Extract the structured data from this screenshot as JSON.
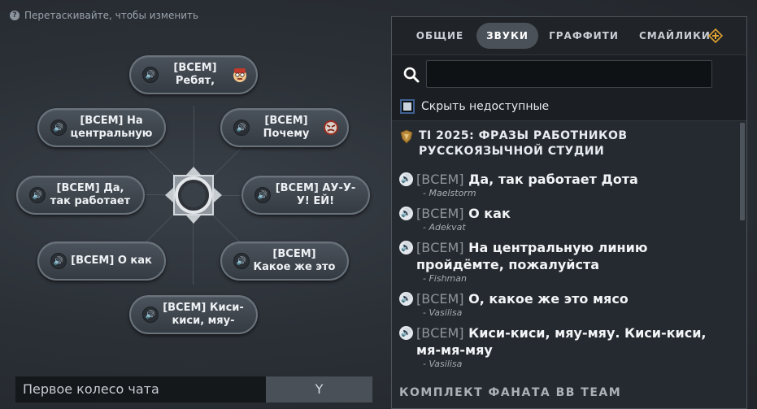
{
  "hint": {
    "icon": "question-icon",
    "text": "Перетаскивайте, чтобы изменить"
  },
  "wheel": {
    "slots": [
      {
        "text": "[ВСЕМ]\nРебят,",
        "emoji": "nerd-face"
      },
      {
        "text": "[ВСЕМ]\nПочему",
        "emoji": "angry-face"
      },
      {
        "text": "[ВСЕМ] АУ-У-\nУ! ЕЙ!",
        "emoji": ""
      },
      {
        "text": "[ВСЕМ]\nКакое же это",
        "emoji": ""
      },
      {
        "text": "[ВСЕМ] Киси-\nкиси, мяу-",
        "emoji": ""
      },
      {
        "text": "[ВСЕМ] О как",
        "emoji": ""
      },
      {
        "text": "[ВСЕМ] Да,\nтак работает",
        "emoji": ""
      },
      {
        "text": "[ВСЕМ] На\nцентральную",
        "emoji": ""
      }
    ],
    "name": "Первое колесо чата",
    "keybind": "Y"
  },
  "panel": {
    "tabs": [
      {
        "label": "ОБЩИЕ",
        "active": false
      },
      {
        "label": "ЗВУКИ",
        "active": true
      },
      {
        "label": "ГРАФФИТИ",
        "active": false
      },
      {
        "label": "СМАЙЛИКИ",
        "active": false
      }
    ],
    "search": {
      "value": "",
      "placeholder": ""
    },
    "hide_unavailable": {
      "label": "Скрыть недоступные",
      "checked": true
    },
    "section_title": "TI 2025: ФРАЗЫ РАБОТНИКОВ РУССКОЯЗЫЧНОЙ СТУДИИ",
    "items": [
      {
        "prefix": "[ВСЕМ]",
        "text": "Да, так работает Дота",
        "author": "- Maelstorm"
      },
      {
        "prefix": "[ВСЕМ]",
        "text": "О как",
        "author": "- Adekvat"
      },
      {
        "prefix": "[ВСЕМ]",
        "text": "На центральную линию пройдёмте, пожалуйста",
        "author": "- Fishman"
      },
      {
        "prefix": "[ВСЕМ]",
        "text": "О, какое же это мясо",
        "author": "- Vasilisa"
      },
      {
        "prefix": "[ВСЕМ]",
        "text": "Киси-киси, мяу-мяу. Киси-киси, мя-мя-мяу",
        "author": "- Vasilisa"
      }
    ],
    "next_section": "КОМПЛЕКТ ФАНАТА BB TEAM"
  },
  "colors": {
    "accent": "#3f5f91",
    "panel_bg": "#1b1e22",
    "plus_badge": "#e0a030"
  }
}
